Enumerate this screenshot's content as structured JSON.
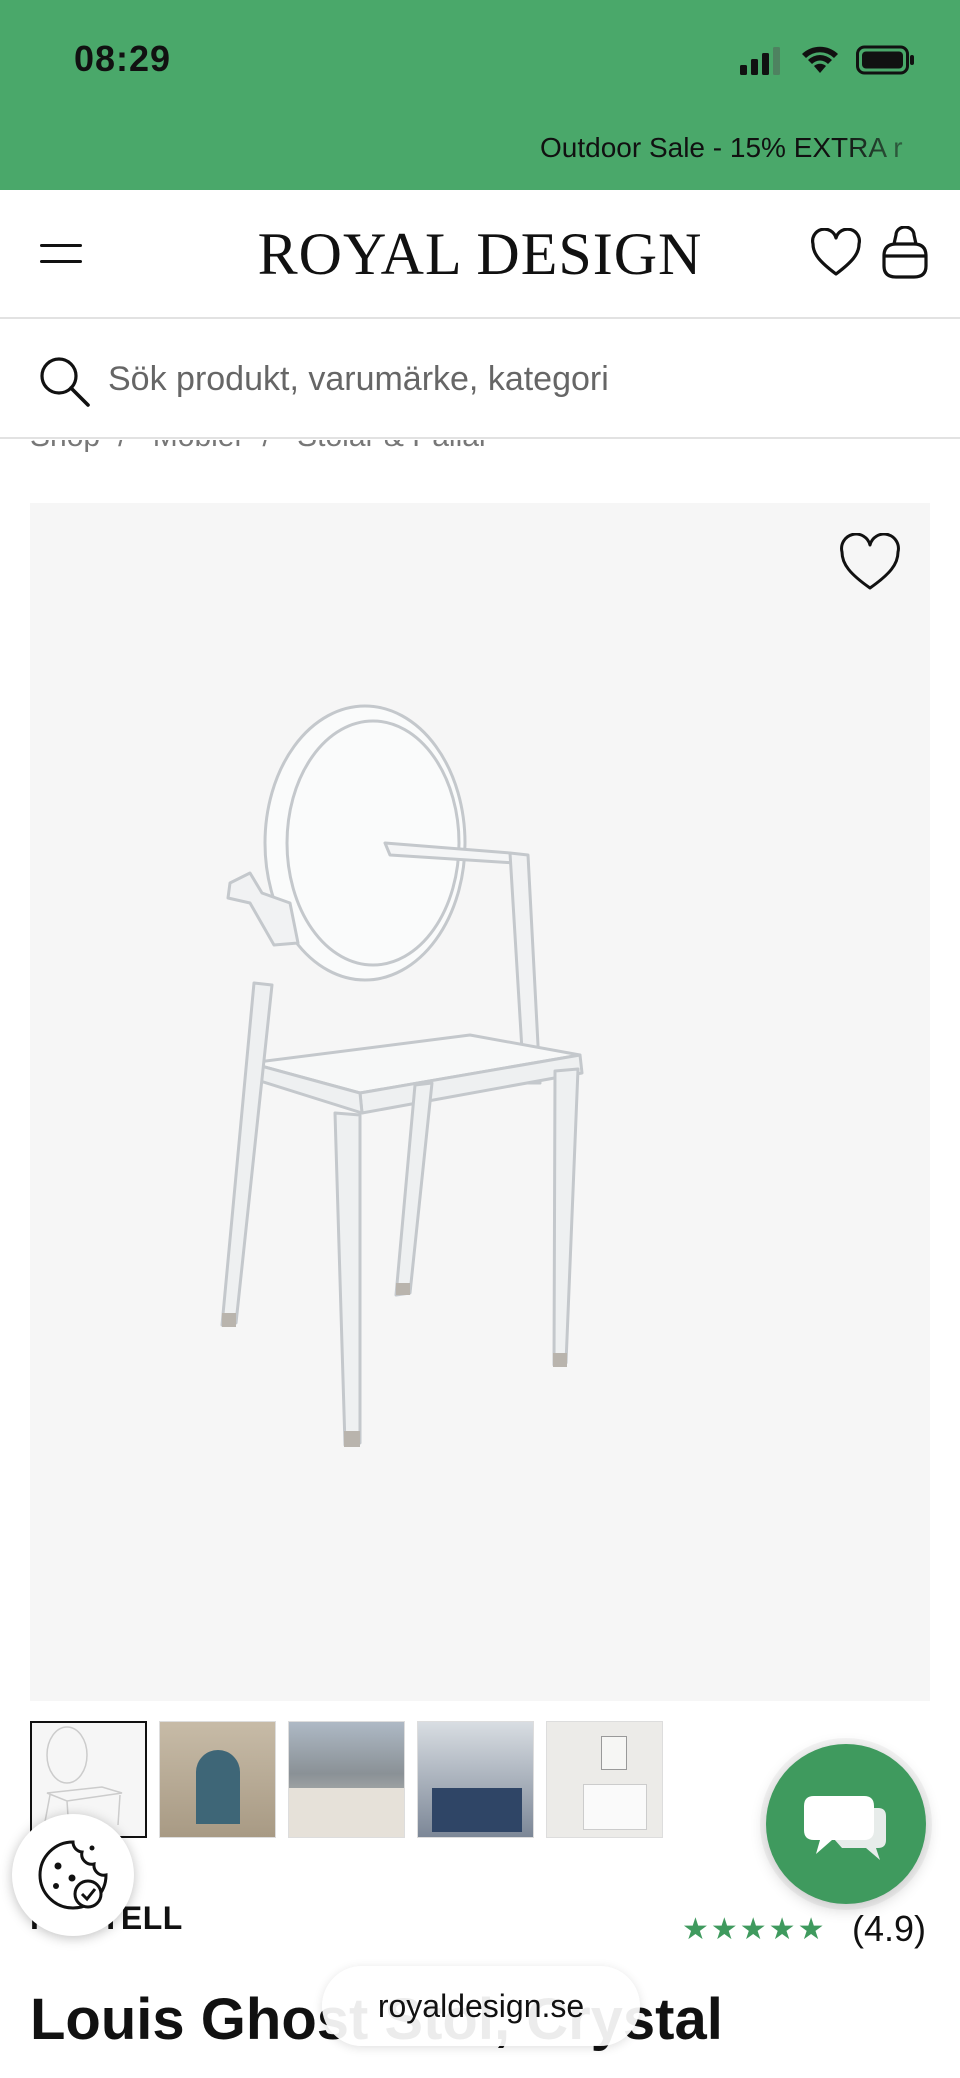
{
  "status_bar": {
    "time": "08:29"
  },
  "promo": {
    "text": "Outdoor Sale - 15% EXTRA r"
  },
  "header": {
    "logo": "ROYAL DESIGN"
  },
  "search": {
    "placeholder": "Sök produkt, varumärke, kategori"
  },
  "breadcrumb": {
    "items": [
      "Shop",
      "Möbler",
      "Stolar & Pallar"
    ]
  },
  "product": {
    "brand": "KARTELL",
    "stars": "★★★★★",
    "rating": "(4.9)",
    "title": "Louis Ghost Stol, Crystal",
    "thumbnail_count": 5
  },
  "browser": {
    "url": "royaldesign.se"
  },
  "colors": {
    "brand_green": "#4aa86a",
    "star_green": "#3f9a5e"
  },
  "icons": {
    "menu": "hamburger-menu-icon",
    "wishlist": "heart-icon",
    "bag": "shopping-bag-icon",
    "search": "search-icon",
    "cookie": "cookie-icon",
    "chat": "chat-bubbles-icon"
  }
}
